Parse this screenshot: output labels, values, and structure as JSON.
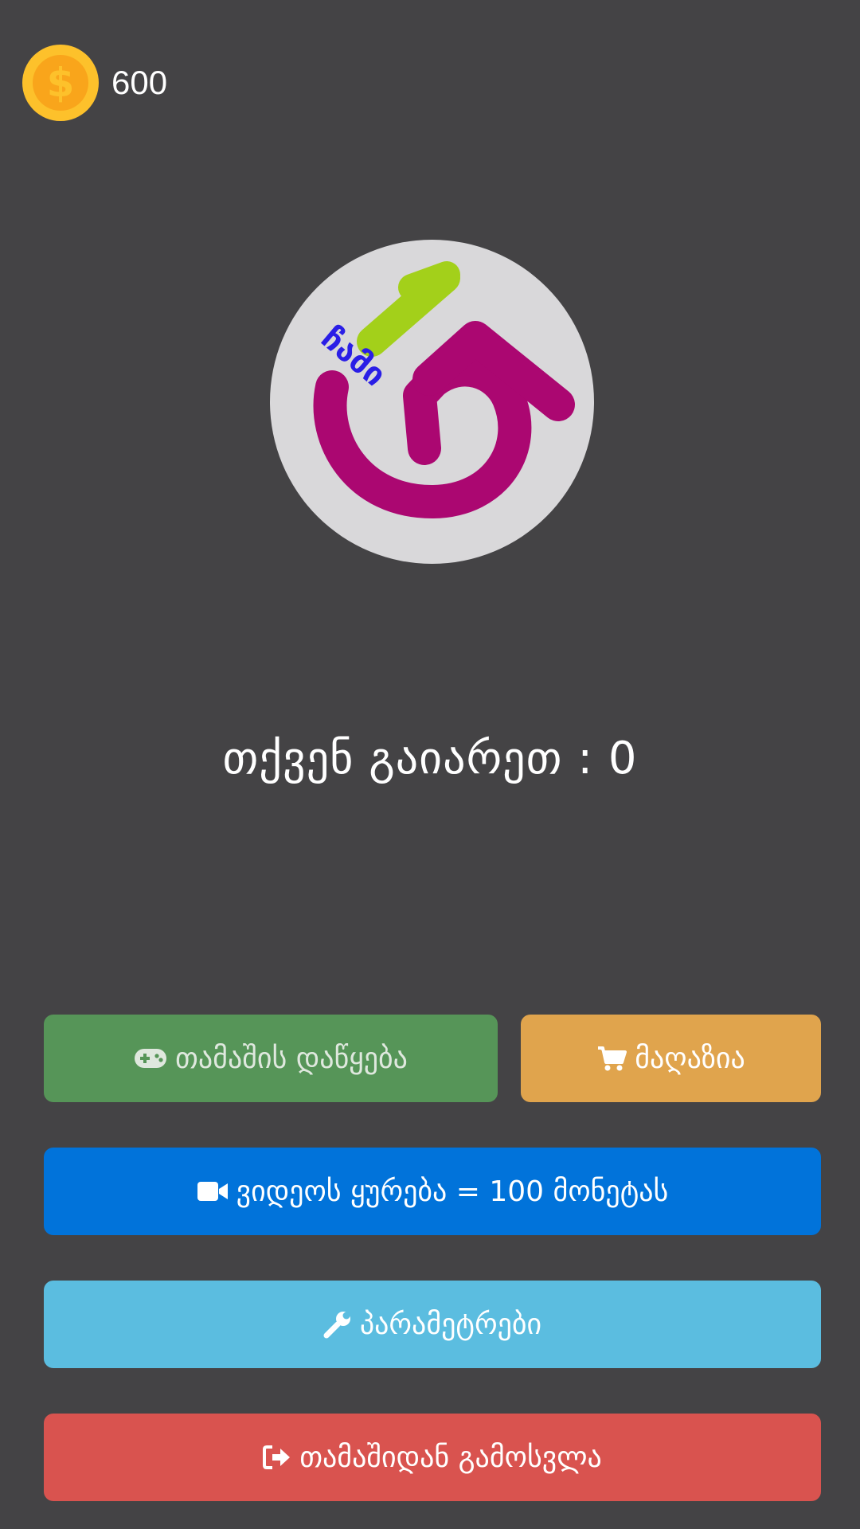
{
  "header": {
    "coin_icon": "dollar-coin-icon",
    "coin_symbol": "$",
    "coins": "600"
  },
  "logo": {
    "text": "ჩამი",
    "colors": {
      "circle": "#d9d8da",
      "main": "#ab0771",
      "accent": "#a3d01a",
      "text": "#2a1ee6"
    }
  },
  "score": {
    "label": "თქვენ გაიარეთ : 0"
  },
  "buttons": {
    "start": {
      "label": "თამაშის დაწყება",
      "icon": "gamepad-icon",
      "color": "#569558"
    },
    "shop": {
      "label": "მაღაზია",
      "icon": "shopping-cart-icon",
      "color": "#e0a44d"
    },
    "video": {
      "label": "ვიდეოს ყურება = 100 მონეტას",
      "icon": "video-camera-icon",
      "color": "#0173da"
    },
    "settings": {
      "label": "პარამეტრები",
      "icon": "wrench-icon",
      "color": "#5bbde0"
    },
    "exit": {
      "label": "თამაშიდან გამოსვლა",
      "icon": "sign-out-icon",
      "color": "#d9534f"
    }
  }
}
